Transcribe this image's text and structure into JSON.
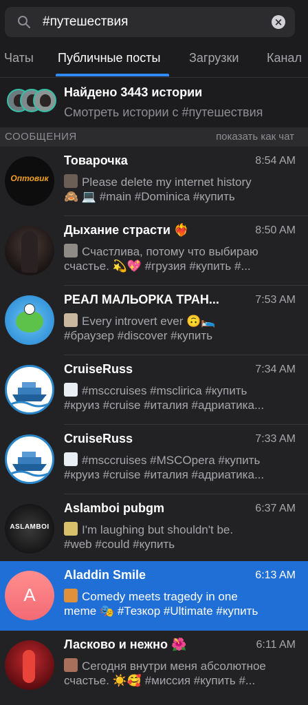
{
  "search": {
    "query": "#путешествия"
  },
  "tabs": [
    {
      "label": "Чаты"
    },
    {
      "label": "Публичные посты"
    },
    {
      "label": "Загрузки"
    },
    {
      "label": "Канал"
    }
  ],
  "stories": {
    "title": "Найдено 3443 истории",
    "subtitle": "Смотреть истории с #путешествия"
  },
  "section": {
    "title": "СООБЩЕНИЯ",
    "action": "показать как чат"
  },
  "colors": {
    "accent": "#2f8cf6",
    "selected_row": "#1f6fd6",
    "background": "#222224"
  },
  "messages": [
    {
      "name": "Товарочка",
      "time": "8:54 AM",
      "line1": "Please delete my internet history",
      "line2": "🙈 💻 #main #Dominica #купить",
      "avatar_text": "Оптовик"
    },
    {
      "name": "Дыхание страсти ❤️‍🔥",
      "time": "8:50 AM",
      "line1": "Счастлива, потому что выбираю",
      "line2": "счастье. 💫💖  #грузия #купить #...",
      "avatar_text": ""
    },
    {
      "name": "РЕАЛ МАЛЬОРКА ТРАН...",
      "time": "7:53 AM",
      "line1": "Every introvert ever 🙃🛌",
      "line2": "#браузер #discover #купить",
      "avatar_text": ""
    },
    {
      "name": "CruiseRuss",
      "time": "7:34 AM",
      "line1": "#msccruises #msclirica #купить",
      "line2": "#круиз #cruise #италия #адриатика...",
      "avatar_text": ""
    },
    {
      "name": "CruiseRuss",
      "time": "7:33 AM",
      "line1": "#msccruises #MSCOpera #купить",
      "line2": "#круиз #cruise #италия #адриатика...",
      "avatar_text": ""
    },
    {
      "name": "Aslamboi pubgm",
      "time": "6:37 AM",
      "line1": "I'm laughing but shouldn't be.",
      "line2": "#web #could #купить",
      "avatar_text": "ASLAMBOI"
    },
    {
      "name": "Aladdin Smile",
      "time": "6:13 AM",
      "line1": "Comedy meets tragedy in one",
      "line2": "meme 🎭 #Тезкор #Ultimate #купить",
      "avatar_text": "A"
    },
    {
      "name": "Ласково и нежно 🌺",
      "time": "6:11 AM",
      "line1": "Сегодня внутри меня абсолютное",
      "line2": "счастье. ☀️🥰 #миссия #купить #...",
      "avatar_text": ""
    }
  ]
}
